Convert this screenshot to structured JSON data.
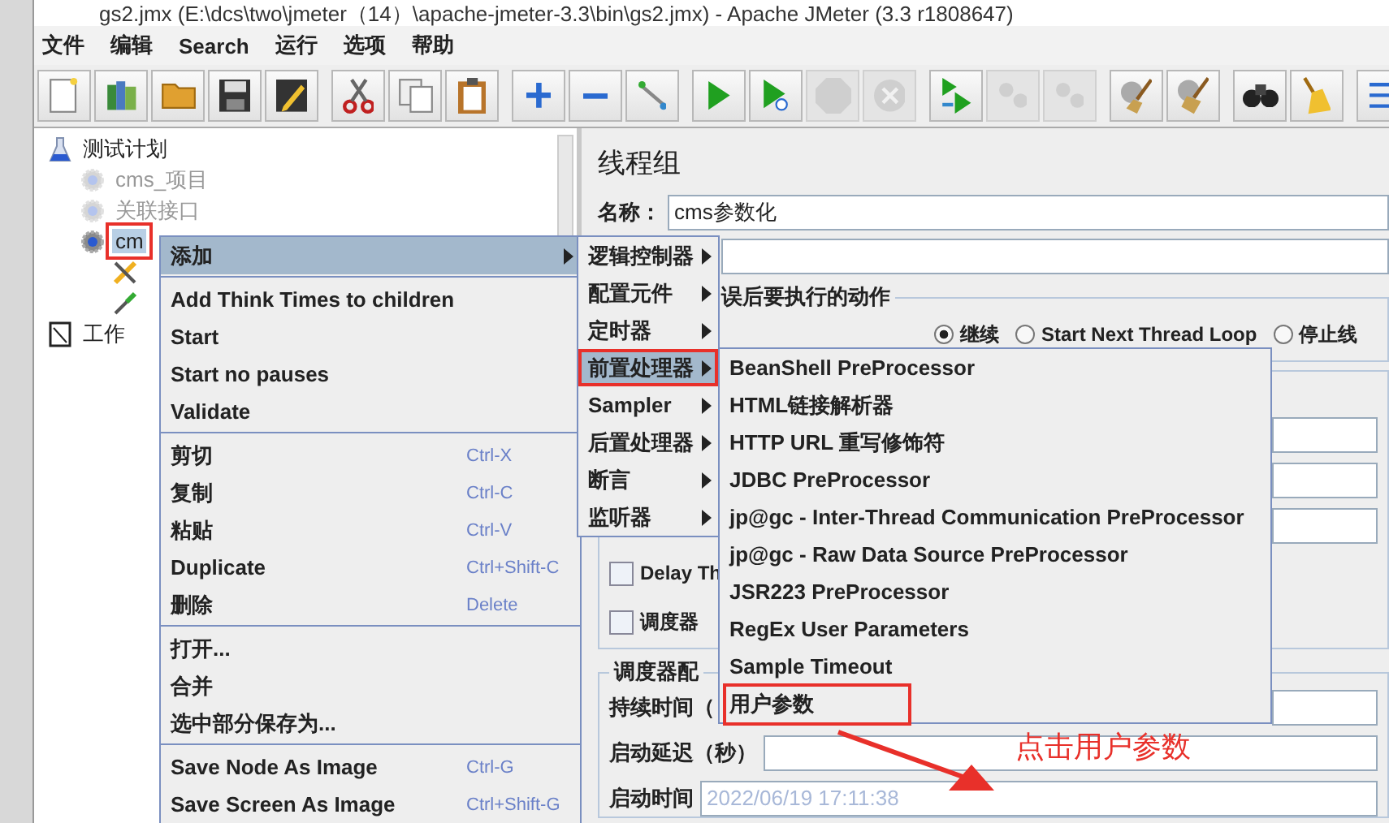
{
  "window": {
    "title": "gs2.jmx (E:\\dcs\\two\\jmeter（14）\\apache-jmeter-3.3\\bin\\gs2.jmx) - Apache JMeter (3.3 r1808647)"
  },
  "menu_bar": [
    "文件",
    "编辑",
    "Search",
    "运行",
    "选项",
    "帮助"
  ],
  "toolbar": [
    [
      {
        "disabled": false
      },
      {
        "disabled": false
      },
      {
        "disabled": false
      },
      {
        "disabled": false
      },
      {
        "disabled": false
      }
    ],
    [
      {
        "disabled": false
      },
      {
        "disabled": false
      },
      {
        "disabled": false
      }
    ],
    [
      {
        "disabled": false
      },
      {
        "disabled": false
      },
      {
        "disabled": false
      }
    ],
    [
      {
        "disabled": false
      },
      {
        "disabled": false
      },
      {
        "disabled": true
      },
      {
        "disabled": true
      }
    ],
    [
      {
        "disabled": false
      },
      {
        "disabled": true
      },
      {
        "disabled": true
      }
    ],
    [
      {
        "disabled": false
      },
      {
        "disabled": false
      }
    ],
    [
      {
        "disabled": false
      },
      {
        "disabled": false
      }
    ],
    [
      {
        "disabled": false
      }
    ]
  ],
  "tree": [
    {
      "kind": "plan",
      "label": "测试计划",
      "enabled": true,
      "selected": false,
      "annotated": false,
      "children": [
        {
          "kind": "group",
          "label": "cms_项目",
          "enabled": false,
          "selected": false,
          "annotated": false
        },
        {
          "kind": "group",
          "label": "关联接口",
          "enabled": false,
          "selected": false,
          "annotated": false
        },
        {
          "kind": "group",
          "label": "cm",
          "enabled": true,
          "selected": true,
          "annotated": true,
          "children": [
            {
              "kind": "tool",
              "enabled": true
            },
            {
              "kind": "probe",
              "enabled": true
            }
          ]
        }
      ]
    },
    {
      "kind": "bench",
      "label": "工作",
      "enabled": true,
      "selected": false,
      "annotated": false
    }
  ],
  "context_menu": [
    {
      "kind": "submenu",
      "label": "添加",
      "selected": true
    },
    {
      "kind": "separator"
    },
    {
      "kind": "item",
      "label": "Add Think Times to children",
      "selected": false
    },
    {
      "kind": "item",
      "label": "Start",
      "selected": false
    },
    {
      "kind": "item",
      "label": "Start no pauses",
      "selected": false
    },
    {
      "kind": "item",
      "label": "Validate",
      "selected": false
    },
    {
      "kind": "separator"
    },
    {
      "kind": "item",
      "label": "剪切",
      "shortcut": "Ctrl-X",
      "selected": false
    },
    {
      "kind": "item",
      "label": "复制",
      "shortcut": "Ctrl-C",
      "selected": false
    },
    {
      "kind": "item",
      "label": "粘贴",
      "shortcut": "Ctrl-V",
      "selected": false
    },
    {
      "kind": "item",
      "label": "Duplicate",
      "shortcut": "Ctrl+Shift-C",
      "selected": false
    },
    {
      "kind": "item",
      "label": "删除",
      "shortcut": "Delete",
      "selected": false
    },
    {
      "kind": "separator"
    },
    {
      "kind": "item",
      "label": "打开...",
      "selected": false
    },
    {
      "kind": "item",
      "label": "合并",
      "selected": false
    },
    {
      "kind": "item",
      "label": "选中部分保存为...",
      "selected": false
    },
    {
      "kind": "separator"
    },
    {
      "kind": "item",
      "label": "Save Node As Image",
      "shortcut": "Ctrl-G",
      "selected": false
    },
    {
      "kind": "item",
      "label": "Save Screen As Image",
      "shortcut": "Ctrl+Shift-G",
      "selected": false
    }
  ],
  "add_submenu": [
    {
      "label": "逻辑控制器",
      "selected": false,
      "annotated": false
    },
    {
      "label": "配置元件",
      "selected": false,
      "annotated": false
    },
    {
      "label": "定时器",
      "selected": false,
      "annotated": false
    },
    {
      "label": "前置处理器",
      "selected": true,
      "annotated": true
    },
    {
      "label": "Sampler",
      "selected": false,
      "annotated": false
    },
    {
      "label": "后置处理器",
      "selected": false,
      "annotated": false
    },
    {
      "label": "断言",
      "selected": false,
      "annotated": false
    },
    {
      "label": "监听器",
      "selected": false,
      "annotated": false
    }
  ],
  "preprocessor_submenu": [
    {
      "label": "BeanShell PreProcessor",
      "selected": false,
      "annotated": false
    },
    {
      "label": "HTML链接解析器",
      "selected": false,
      "annotated": false
    },
    {
      "label": "HTTP URL 重写修饰符",
      "selected": false,
      "annotated": false
    },
    {
      "label": "JDBC PreProcessor",
      "selected": false,
      "annotated": false
    },
    {
      "label": "jp@gc - Inter-Thread Communication PreProcessor",
      "selected": false,
      "annotated": false
    },
    {
      "label": "jp@gc - Raw Data Source PreProcessor",
      "selected": false,
      "annotated": false
    },
    {
      "label": "JSR223 PreProcessor",
      "selected": false,
      "annotated": false
    },
    {
      "label": "RegEx User Parameters",
      "selected": false,
      "annotated": false
    },
    {
      "label": "Sample Timeout",
      "selected": false,
      "annotated": false
    },
    {
      "label": "用户参数",
      "selected": false,
      "annotated": true
    }
  ],
  "annotation": {
    "text": "点击用户参数"
  },
  "thread_group": {
    "title": "线程组",
    "name_label": "名称：",
    "name_value": "cms参数化",
    "error_action": {
      "legend": "误后要执行的动作",
      "options": [
        {
          "label": "继续",
          "selected": true
        },
        {
          "label": "Start Next Thread Loop",
          "selected": false
        },
        {
          "label": "停止线",
          "selected": false
        }
      ]
    },
    "checkboxes": [
      {
        "label": "Delay Th",
        "checked": false
      },
      {
        "label": "调度器",
        "checked": false
      }
    ],
    "scheduler": {
      "legend": "调度器配",
      "fields": [
        {
          "label": "持续时间（"
        },
        {
          "label": "启动延迟（秒）"
        },
        {
          "label": "启动时间",
          "value": "2022/06/19 17:11:38"
        }
      ]
    }
  }
}
